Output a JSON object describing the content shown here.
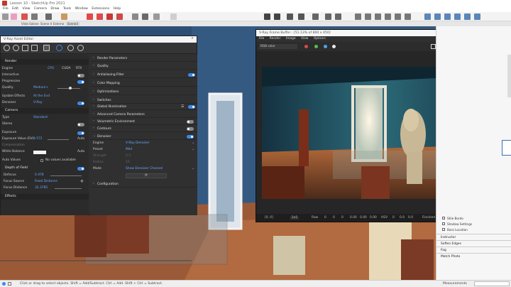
{
  "app": {
    "title": "Lesson 10 - SketchUp Pro 2021"
  },
  "menu": [
    "File",
    "Edit",
    "View",
    "Camera",
    "Draw",
    "Tools",
    "Window",
    "Extensions",
    "Help"
  ],
  "scene_tabs": [
    "Vista Salone",
    "Scene 4",
    "Esterno",
    "Scene3"
  ],
  "status": {
    "message": "Click or drag to select objects. Shift = Add/Subtract. Ctrl = Add. Shift + Ctrl = Subtract.",
    "measurements_label": "Measurements"
  },
  "asset_editor": {
    "title": "V-Ray Asset Editor",
    "left": {
      "render_section": "Render",
      "engine_label": "Engine",
      "engine_options": [
        "CPU",
        "CUDA",
        "RTX"
      ],
      "interactive_label": "Interactive",
      "progressive_label": "Progressive",
      "quality_label": "Quality",
      "quality_value": "Medium+",
      "update_effects_label": "Update Effects",
      "update_effects_value": "At the End",
      "denoiser_label": "Denoiser",
      "denoiser_value": "V-Ray",
      "camera_section": "Camera",
      "type_label": "Type",
      "type_value": "Standard",
      "stereo_label": "Stereo",
      "exposure_label": "Exposure",
      "exposure_value_label": "Exposure Value (EV)",
      "exposure_value": "8.572",
      "auto_label": "Auto",
      "compensation_label": "Compensation",
      "white_balance_label": "White Balance",
      "auto_values_label": "Auto Values",
      "no_values_text": "No values available",
      "dof_section": "Depth of Field",
      "defocus_label": "Defocus",
      "defocus_value": "0.478",
      "focus_source_label": "Focus Source",
      "focus_source_value": "Fixed Distance",
      "focus_distance_label": "Focus Distance",
      "focus_distance_value": "32.3785",
      "effects_section": "Effects"
    },
    "right": {
      "sections": [
        "Render Parameters",
        "Quality",
        "Antialiasing Filter",
        "Color Mapping",
        "Optimizations",
        "Switches",
        "Global Illumination",
        "Advanced Camera Parameters",
        "Volumetric Environment",
        "Contours",
        "Denoiser"
      ],
      "engine_label": "Engine",
      "engine_value": "V-Ray Denoiser",
      "preset_label": "Preset",
      "preset_value": "Mild",
      "strength_label": "Strength",
      "strength_value": "0.5",
      "radius_label": "Radius",
      "radius_value": "10",
      "mode_label": "Mode",
      "mode_value": "Show Denoiser Channel",
      "configuration_label": "Configuration"
    }
  },
  "frame_buffer": {
    "title": "V-Ray Frame Buffer - [51.13% of 800 x 450]",
    "menu": [
      "File",
      "Render",
      "Image",
      "View",
      "Options"
    ],
    "channel": "RGB color",
    "channel_colors": [
      "#d94a4a",
      "#4fc24f",
      "#4aa3f0",
      "#e8e8e8"
    ],
    "status_coords": "[0, 0]",
    "status_mode": "1x1",
    "status_items": [
      "Raw",
      "0",
      "0",
      "0",
      "0.00",
      "0.00",
      "0.00",
      "HSV",
      "0",
      "0.0",
      "0.0",
      "Finished"
    ]
  },
  "right_panel": {
    "items": [
      "Stile Bordo",
      "Shadow Settings",
      "Bass Location"
    ],
    "trays": [
      "Instructor",
      "Soften Edges",
      "Fog",
      "Match Photo"
    ]
  },
  "colors": {
    "accent": "#3b8ae6",
    "value_blue": "#6aa8ff",
    "wall_blue": "#2d4f73"
  }
}
